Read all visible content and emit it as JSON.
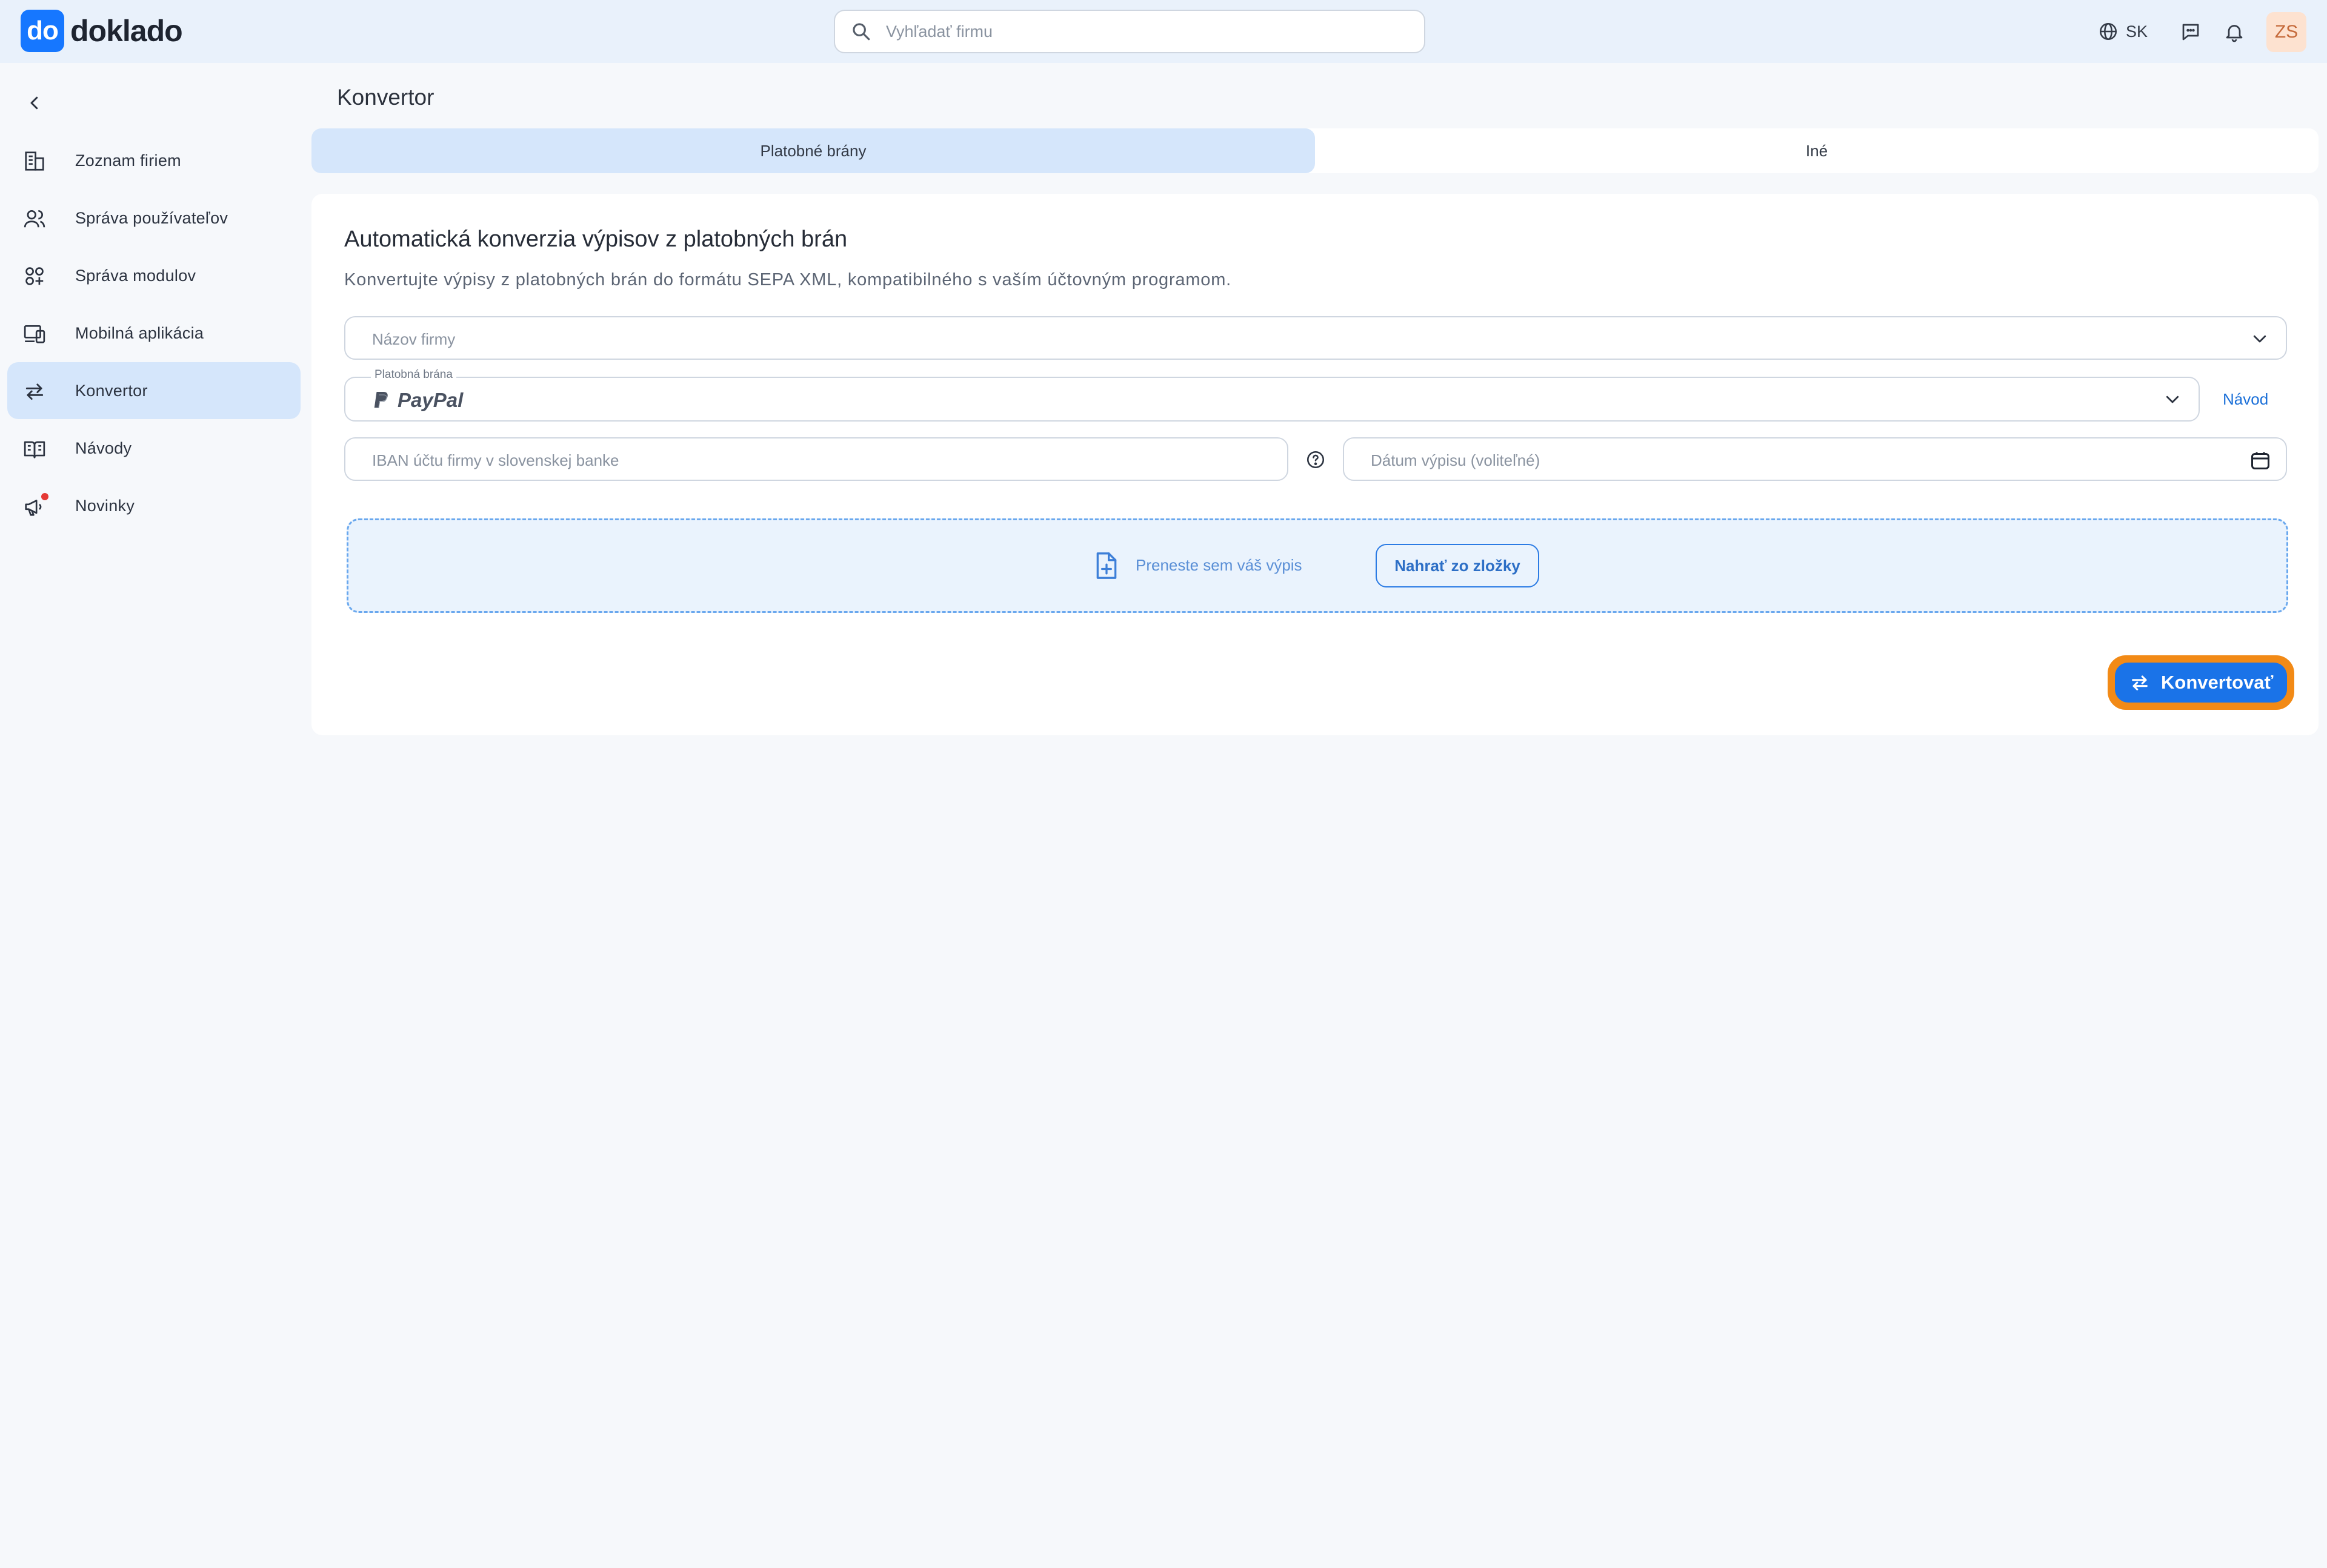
{
  "app": {
    "logo_mark": "do",
    "logo_text": "doklado"
  },
  "header": {
    "search_placeholder": "Vyhľadať firmu",
    "language": "SK",
    "avatar_initials": "ZS"
  },
  "sidebar": {
    "items": [
      {
        "label": "Zoznam firiem",
        "icon": "building-icon",
        "active": false
      },
      {
        "label": "Správa používateľov",
        "icon": "users-icon",
        "active": false
      },
      {
        "label": "Správa modulov",
        "icon": "modules-icon",
        "active": false
      },
      {
        "label": "Mobilná aplikácia",
        "icon": "devices-icon",
        "active": false
      },
      {
        "label": "Konvertor",
        "icon": "arrows-swap-icon",
        "active": true
      },
      {
        "label": "Návody",
        "icon": "book-icon",
        "active": false
      },
      {
        "label": "Novinky",
        "icon": "megaphone-icon",
        "active": false,
        "has_notification_dot": true
      }
    ]
  },
  "main": {
    "page_title": "Konvertor",
    "tabs": [
      {
        "label": "Platobné brány",
        "active": true
      },
      {
        "label": "Iné",
        "active": false
      }
    ],
    "card": {
      "title": "Automatická konverzia výpisov z platobných brán",
      "description": "Konvertujte výpisy z platobných brán do formátu SEPA XML, kompatibilného s vaším účtovným programom.",
      "company_select_placeholder": "Názov firmy",
      "gateway_label": "Platobná brána",
      "gateway_value": "PayPal",
      "guide_link": "Návod",
      "iban_placeholder": "IBAN účtu firmy v slovenskej banke",
      "date_placeholder": "Dátum výpisu (voliteľné)",
      "dropzone_text": "Preneste sem váš výpis",
      "upload_button": "Nahrať zo zložky",
      "convert_button": "Konvertovať"
    }
  },
  "colors": {
    "primary": "#1a73e8",
    "active_bg": "#d5e6fb",
    "focus_ring": "#f28a16",
    "header_bg": "#e9f1fb",
    "page_bg": "#f6f8fb"
  }
}
